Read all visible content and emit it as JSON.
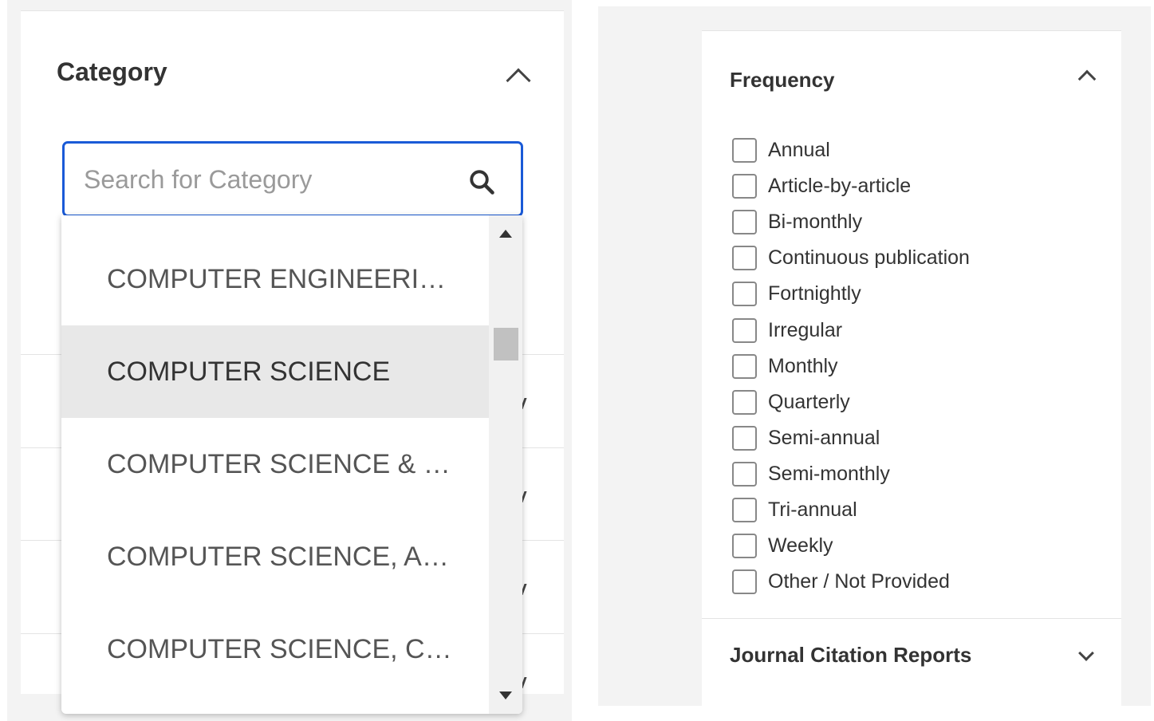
{
  "category_filter": {
    "title": "Category",
    "search": {
      "placeholder": "Search for Category",
      "value": ""
    },
    "options": [
      {
        "label": "COMPUTER ENGINEERING",
        "selected": false
      },
      {
        "label": "COMPUTER SCIENCE",
        "selected": true
      },
      {
        "label": "COMPUTER SCIENCE & ENGINEERING",
        "selected": false
      },
      {
        "label": "COMPUTER SCIENCE, ARTIFICIAL INTELLIGENCE",
        "selected": false
      },
      {
        "label": "COMPUTER SCIENCE, CYBERNETICS",
        "selected": false
      }
    ]
  },
  "frequency_filter": {
    "title": "Frequency",
    "options": [
      {
        "label": "Annual",
        "checked": false
      },
      {
        "label": "Article-by-article",
        "checked": false
      },
      {
        "label": "Bi-monthly",
        "checked": false
      },
      {
        "label": "Continuous publication",
        "checked": false
      },
      {
        "label": "Fortnightly",
        "checked": false
      },
      {
        "label": "Irregular",
        "checked": false
      },
      {
        "label": "Monthly",
        "checked": false
      },
      {
        "label": "Quarterly",
        "checked": false
      },
      {
        "label": "Semi-annual",
        "checked": false
      },
      {
        "label": "Semi-monthly",
        "checked": false
      },
      {
        "label": "Tri-annual",
        "checked": false
      },
      {
        "label": "Weekly",
        "checked": false
      },
      {
        "label": "Other / Not Provided",
        "checked": false
      }
    ]
  },
  "jcr_filter": {
    "title": "Journal Citation Reports"
  },
  "icons": {
    "category_collapse": "chevron-up-icon",
    "search": "search-icon",
    "frequency_collapse": "chevron-up-icon",
    "jcr_expand": "chevron-down-icon"
  },
  "colors": {
    "focus_border": "#1a5ad7",
    "selected_option_bg": "#e8e8e8"
  }
}
